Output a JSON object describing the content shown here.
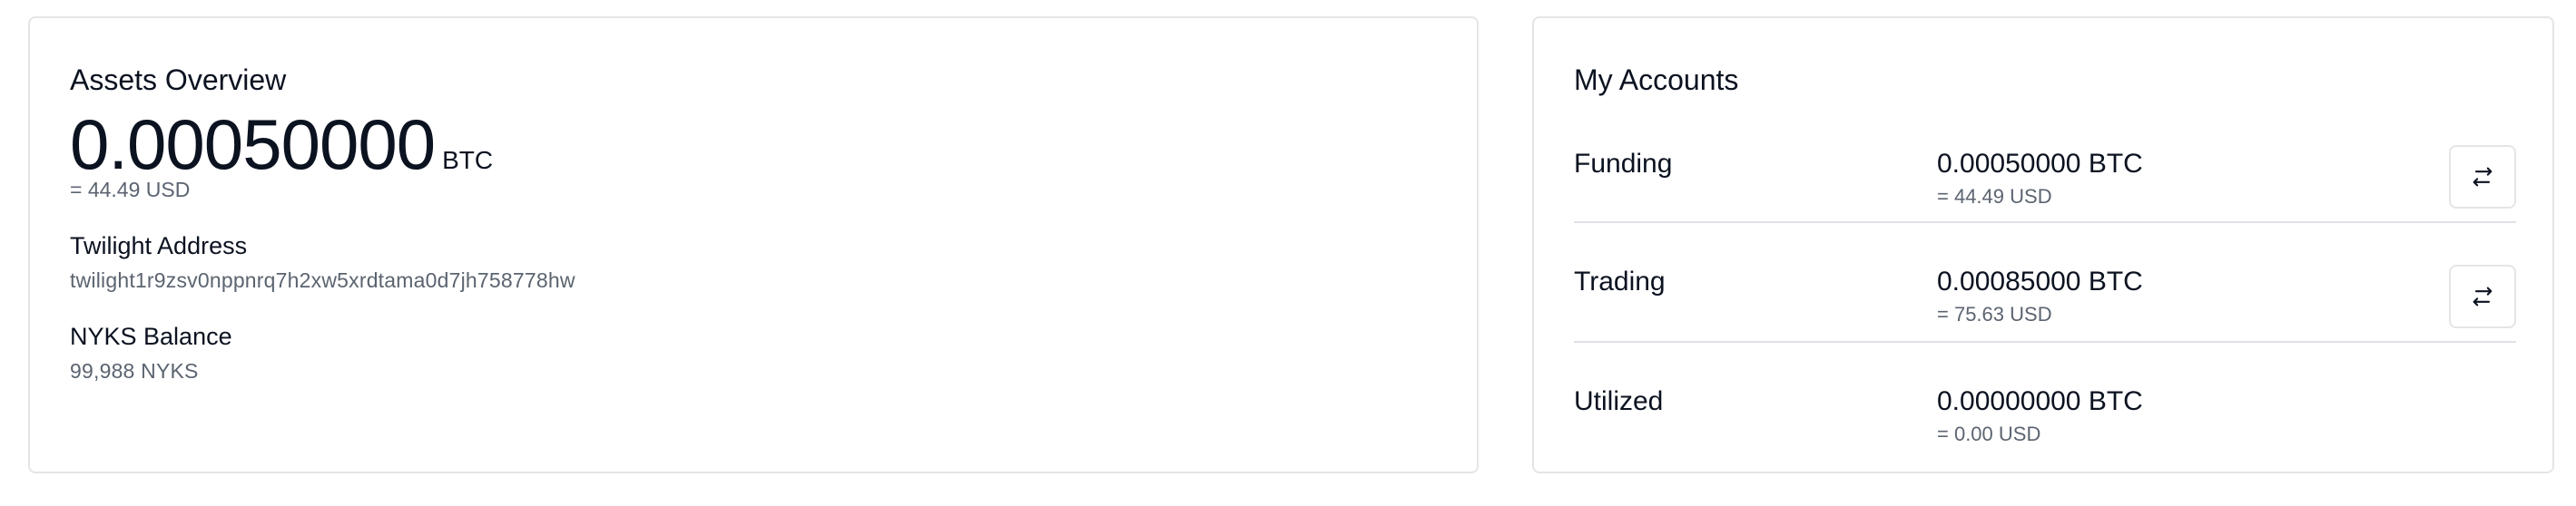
{
  "assets_overview": {
    "title": "Assets Overview",
    "btc_amount": "0.00050000",
    "btc_unit": "BTC",
    "usd_equivalent": "= 44.49 USD",
    "twilight_address_label": "Twilight Address",
    "twilight_address_value": "twilight1r9zsv0nppnrq7h2xw5xrdtama0d7jh758778hw",
    "nyks_balance_label": "NYKS Balance",
    "nyks_balance_value": "99,988 NYKS"
  },
  "my_accounts": {
    "title": "My Accounts",
    "accounts": [
      {
        "name": "Funding",
        "btc": "0.00050000 BTC",
        "usd": "= 44.49 USD",
        "transfer_icon": "transfer-arrows-icon"
      },
      {
        "name": "Trading",
        "btc": "0.00085000 BTC",
        "usd": "= 75.63 USD",
        "transfer_icon": "transfer-arrows-icon"
      },
      {
        "name": "Utilized",
        "btc": "0.00000000 BTC",
        "usd": "= 0.00 USD"
      }
    ]
  },
  "colors": {
    "text_primary": "#0b1220",
    "text_secondary": "#5b6470",
    "border": "#e3e5e8"
  }
}
